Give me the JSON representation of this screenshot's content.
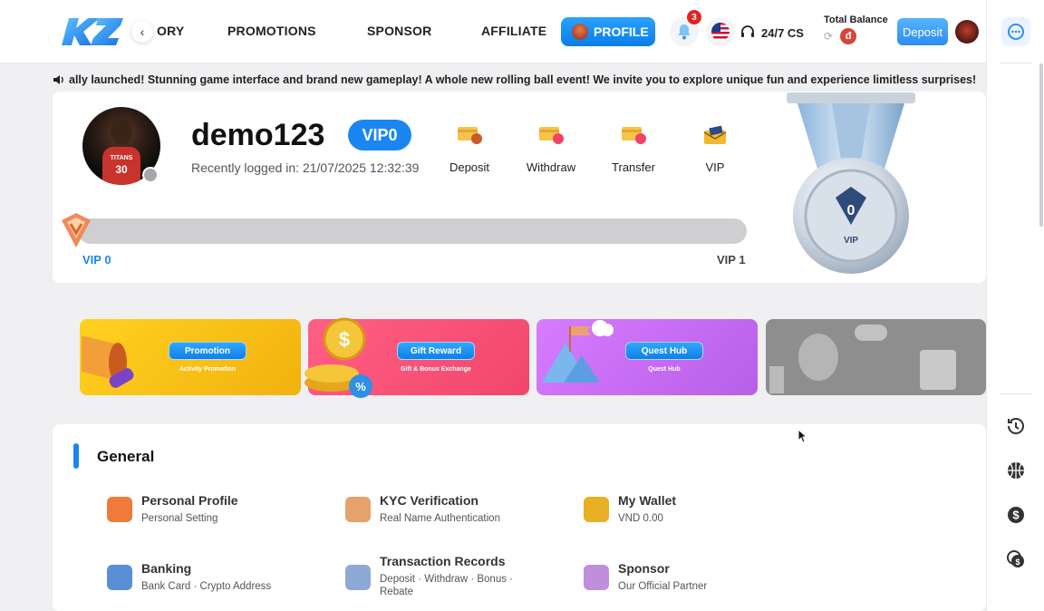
{
  "header": {
    "logo_text": "KZ",
    "nav_items": [
      "ORY",
      "PROMOTIONS",
      "SPONSOR",
      "AFFILIATE"
    ],
    "profile_label": "PROFILE",
    "notification_count": "3",
    "support_label": "24/7 CS",
    "balance_label": "Total Balance",
    "balance_currency": "đ",
    "deposit_label": "Deposit"
  },
  "marquee": {
    "text": "ally launched! Stunning game interface and brand new gameplay! A whole new rolling ball event! We invite you to explore unique fun and experience limitless surprises!"
  },
  "profile": {
    "username": "demo123",
    "vip_badge": "VIP0",
    "jersey_team": "TITANS",
    "jersey_number": "30",
    "last_login": "Recently logged in: 21/07/2025 12:32:39",
    "actions": [
      "Deposit",
      "Withdraw",
      "Transfer",
      "VIP"
    ],
    "progress_fraction": 0,
    "vip_current": "VIP 0",
    "vip_next": "VIP 1",
    "medal_level": "0",
    "medal_text": "VIP"
  },
  "promos": [
    {
      "label": "Promotion",
      "sub": "Activity Promotion",
      "color": "#f6c21b"
    },
    {
      "label": "Gift Reward",
      "sub": "Gift & Bonus Exchange",
      "color": "#f2557a"
    },
    {
      "label": "Quest Hub",
      "sub": "Quest Hub",
      "color": "#c86df0"
    },
    {
      "label": "",
      "sub": "",
      "color": "#8d8d8d"
    }
  ],
  "general": {
    "title": "General",
    "items": [
      {
        "title": "Personal Profile",
        "sub": "Personal Setting"
      },
      {
        "title": "KYC Verification",
        "sub": "Real Name Authentication"
      },
      {
        "title": "My Wallet",
        "sub": "VND 0.00"
      },
      {
        "title": "Banking",
        "sub": "Bank Card · Crypto Address"
      },
      {
        "title": "Transaction Records",
        "sub": "Deposit · Withdraw · Bonus · Rebate"
      },
      {
        "title": "Sponsor",
        "sub": "Our Official Partner"
      }
    ]
  },
  "colors": {
    "accent": "#1b86f2",
    "badge": "#e02424"
  }
}
